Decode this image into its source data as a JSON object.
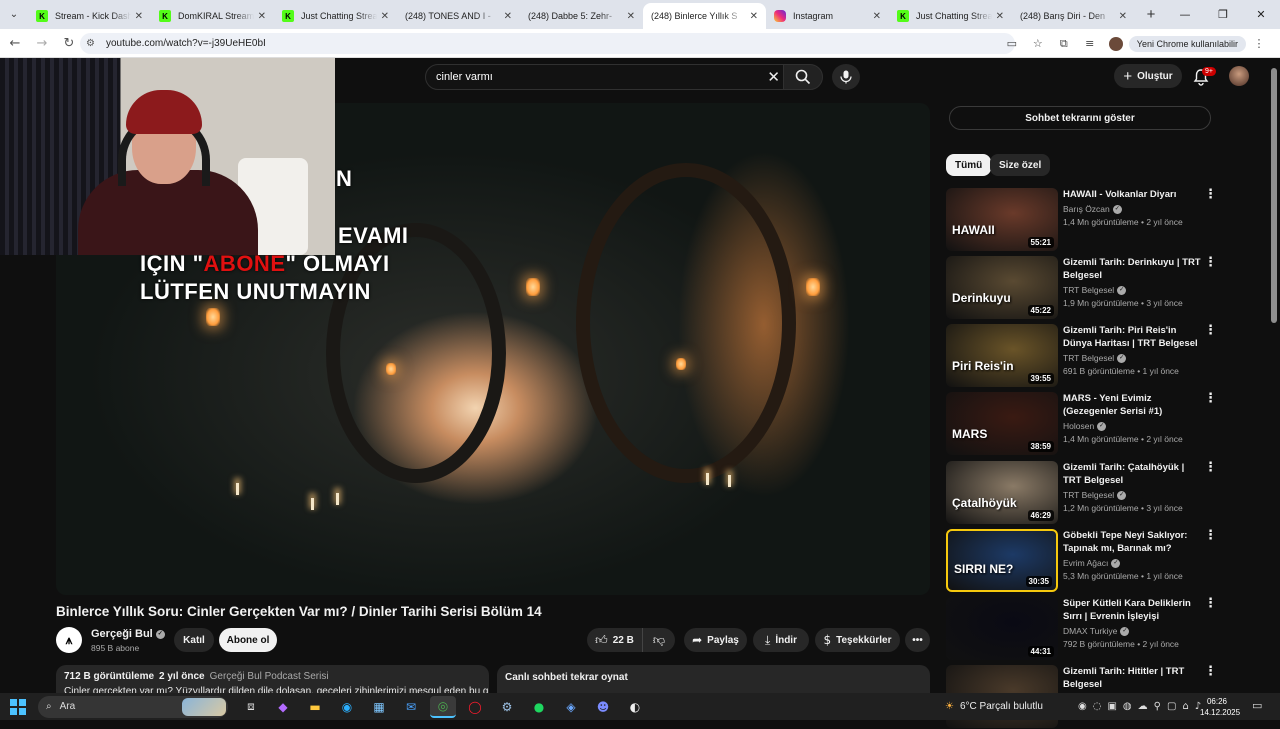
{
  "browser": {
    "tabs": [
      {
        "title": "Stream - Kick Dashbo",
        "icon": "kick-icon",
        "active": false
      },
      {
        "title": "DomKIRAL Stream - V",
        "icon": "kick-icon",
        "active": false
      },
      {
        "title": "Just Chatting Stream",
        "icon": "kick-icon",
        "active": false
      },
      {
        "title": "(248) TONES AND I -",
        "icon": "youtube-icon",
        "active": false
      },
      {
        "title": "(248) Dabbe 5: Zehr-",
        "icon": "youtube-icon",
        "active": false
      },
      {
        "title": "(248) Binlerce Yıllık S",
        "icon": "youtube-icon",
        "active": true
      },
      {
        "title": "Instagram",
        "icon": "instagram-icon",
        "active": false
      },
      {
        "title": "Just Chatting Stream",
        "icon": "kick-icon",
        "active": false
      },
      {
        "title": "(248) Barış Diri - Den",
        "icon": "youtube-icon",
        "active": false
      }
    ],
    "url": "youtube.com/watch?v=-j39UeHE0bI",
    "new_chrome_label": "Yeni Chrome kullanılabilir"
  },
  "youtube": {
    "search_value": "cinler varmı",
    "create_label": "Oluştur",
    "notif_badge": "9+",
    "video": {
      "overlay_line1": "N",
      "overlay_line2": "EVAMI",
      "overlay_line3_pre": "İÇİN \"",
      "overlay_line3_red": "ABONE",
      "overlay_line3_post": "\" OLMAYI",
      "overlay_line4": "LÜTFEN UNUTMAYIN",
      "title": "Binlerce Yıllık Soru: Cinler Gerçekten Var mı? / Dinler Tarihi Serisi Bölüm 14"
    },
    "channel": {
      "name": "Gerçeği Bul",
      "subs": "895 B abone",
      "join_label": "Katıl",
      "subscribe_label": "Abone ol"
    },
    "actions": {
      "likes": "22 B",
      "share": "Paylaş",
      "download": "İndir",
      "thanks": "Teşekkürler"
    },
    "description": {
      "views": "712 B görüntüleme",
      "age": "2 yıl önce",
      "playlist": "Gerçeği Bul Podcast Serisi",
      "text": "Cinler gerçekten var mı? Yüzyıllardır dilden dile dolaşan, geceleri zihinlerimizi meşgul eden bu gizemli"
    },
    "chat_replay_label": "Canlı sohbeti tekrar oynat",
    "show_chat_label": "Sohbet tekrarını göster",
    "chips": [
      "Tümü",
      "Size özel"
    ],
    "recommendations": [
      {
        "title": "HAWAII - Volkanlar Diyarı",
        "channel": "Barış Özcan",
        "views": "1,4 Mn görüntüleme",
        "age": "2 yıl önce",
        "duration": "55:21",
        "thumb_text": "HAWAII",
        "color": "#6a3a2a"
      },
      {
        "title": "Gizemli Tarih: Derinkuyu | TRT Belgesel",
        "channel": "TRT Belgesel",
        "views": "1,9 Mn görüntüleme",
        "age": "3 yıl önce",
        "duration": "45:22",
        "thumb_text": "Derinkuyu",
        "color": "#5a4a32"
      },
      {
        "title": "Gizemli Tarih: Piri Reis'in Dünya Haritası | TRT Belgesel",
        "channel": "TRT Belgesel",
        "views": "691 B görüntüleme",
        "age": "1 yıl önce",
        "duration": "39:55",
        "thumb_text": "Piri Reis'in",
        "color": "#6a5428"
      },
      {
        "title": "MARS - Yeni Evimiz (Gezegenler Serisi #1)",
        "channel": "Holosen",
        "views": "1,4 Mn görüntüleme",
        "age": "2 yıl önce",
        "duration": "38:59",
        "thumb_text": "MARS",
        "color": "#3a1a12"
      },
      {
        "title": "Gizemli Tarih: Çatalhöyük | TRT Belgesel",
        "channel": "TRT Belgesel",
        "views": "1,2 Mn görüntüleme",
        "age": "3 yıl önce",
        "duration": "46:29",
        "thumb_text": "Çatalhöyük",
        "color": "#8a7a66"
      },
      {
        "title": "Göbekli Tepe Neyi Saklıyor: Tapınak mı, Barınak mı?",
        "channel": "Evrim Ağacı",
        "views": "5,3 Mn görüntüleme",
        "age": "1 yıl önce",
        "duration": "30:35",
        "thumb_text": "SIRRI NE?",
        "color": "#1d3a66"
      },
      {
        "title": "Süper Kütleli Kara Deliklerin Sırrı | Evrenin İşleyişi",
        "channel": "DMAX Turkiye",
        "views": "792 B görüntüleme",
        "age": "2 yıl önce",
        "duration": "44:31",
        "thumb_text": "",
        "color": "#0a0a14"
      },
      {
        "title": "Gizemli Tarih: Hititler | TRT Belgesel",
        "channel": "TRT Belgesel",
        "views": "",
        "age": "",
        "duration": "",
        "thumb_text": "",
        "color": "#4a3a2a"
      }
    ]
  },
  "taskbar": {
    "search_label": "Ara",
    "weather": "6°C  Parçalı bulutlu",
    "time": "06:26",
    "date": "14.12.2025"
  }
}
